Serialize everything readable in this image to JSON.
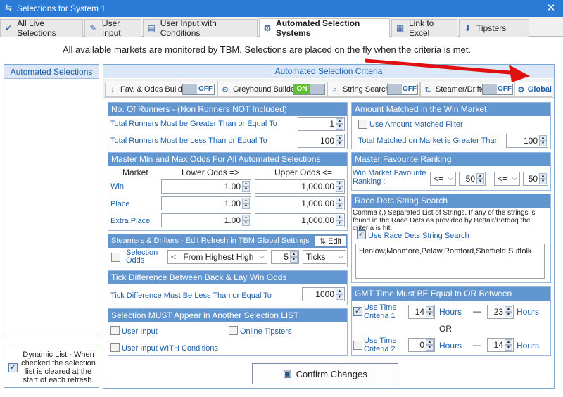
{
  "window": {
    "title": "Selections for System 1",
    "close": "✕"
  },
  "tabs": [
    {
      "label": "All Live Selections",
      "icon": "checkmark-icon"
    },
    {
      "label": "User Input",
      "icon": "edit-icon"
    },
    {
      "label": "User Input with Conditions",
      "icon": "document-icon"
    },
    {
      "label": "Automated Selection Systems",
      "icon": "android-icon"
    },
    {
      "label": "Link to Excel",
      "icon": "excel-icon"
    },
    {
      "label": "Tipsters",
      "icon": "download-icon"
    }
  ],
  "info": "All available markets are monitored by TBM. Selections are placed on the fly when the criteria is met.",
  "left": {
    "title": "Automated Selections",
    "dynamic": "Dynamic List - When checked the selection list is cleared at the start of each refresh."
  },
  "criteria": {
    "title": "Automated Selection Criteria",
    "subtabs": [
      {
        "label": "Fav. & Odds Builder",
        "state": "OFF"
      },
      {
        "label": "Greyhound Builder",
        "state": "ON"
      },
      {
        "label": "String Search",
        "state": "OFF"
      },
      {
        "label": "Steamer/Drifter",
        "state": "OFF"
      },
      {
        "label": "Global",
        "state": ""
      }
    ],
    "runners": {
      "title": "No. Of Runners - (Non Runners NOT Included)",
      "gt_label": "Total Runners Must be Greater Than or Equal To",
      "gt": "1",
      "lt_label": "Total Runners Must be Less Than or Equal To",
      "lt": "100"
    },
    "odds": {
      "title": "Master Min and Max Odds For All Automated Selections",
      "col_market": "Market",
      "col_lower": "Lower Odds =>",
      "col_upper": "Upper Odds <=",
      "rows": [
        {
          "market": "Win",
          "lower": "1.00",
          "upper": "1,000.00"
        },
        {
          "market": "Place",
          "lower": "1.00",
          "upper": "1,000.00"
        },
        {
          "market": "Extra Place",
          "lower": "1.00",
          "upper": "1,000.00"
        }
      ]
    },
    "steamers": {
      "title": "Steamers & Drifters - Edit Refresh in TBM Global Settings",
      "edit": "Edit",
      "sel_odds": "Selection Odds",
      "from": "<= From Highest High",
      "count": "5",
      "unit": "Ticks"
    },
    "tick": {
      "title": "Tick Difference Between Back & Lay Win Odds",
      "label": "Tick Difference Must Be Less Than or Equal To",
      "value": "1000"
    },
    "another": {
      "title": "Selection MUST Appear in Another Selection LIST",
      "user_input": "User Input",
      "online": "Online Tipsters",
      "user_cond": "User Input WITH Conditions"
    },
    "amount": {
      "title": "Amount Matched in the Win Market",
      "use": "Use Amount Matched Filter",
      "label": "Total Matched on Market is Greater Than",
      "value": "100"
    },
    "fav": {
      "title": "Master Favourite Ranking",
      "label": "Win Market Favourite Ranking :",
      "op1": "<=",
      "v1": "50",
      "op2": "<=",
      "v2": "50"
    },
    "race": {
      "title": "Race Dets String Search",
      "desc": "Comma (,) Separated List of Strings. If any of the strings is found in the Race Dets as provided by Betfair/Betdaq the criteria is hit.",
      "use": "Use Race Dets String Search",
      "text": "Henlow,Monmore,Pelaw,Romford,Sheffield,Suffolk"
    },
    "gmt": {
      "title": "GMT Time Must BE Equal to OR Between",
      "c1": "Use Time Criteria 1",
      "c1a": "14",
      "c1b": "23",
      "or": "OR",
      "c2": "Use Time Criteria 2",
      "c2a": "0",
      "c2b": "14",
      "hours": "Hours",
      "dash": "—"
    },
    "confirm": "Confirm Changes"
  },
  "colors": {
    "accent": "#2b7bd6",
    "header": "#6196d0",
    "arrow": "#e01010"
  }
}
